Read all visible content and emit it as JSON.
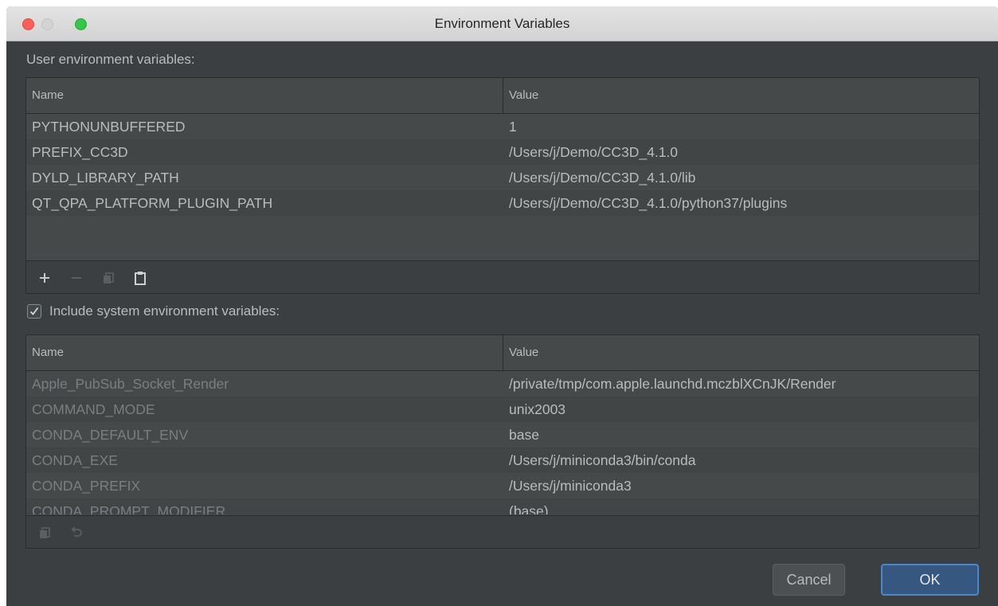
{
  "window": {
    "title": "Environment Variables"
  },
  "user_section": {
    "label": "User environment variables:",
    "columns": {
      "name": "Name",
      "value": "Value"
    },
    "rows": [
      {
        "name": "PYTHONUNBUFFERED",
        "value": "1"
      },
      {
        "name": "PREFIX_CC3D",
        "value": "/Users/j/Demo/CC3D_4.1.0"
      },
      {
        "name": "DYLD_LIBRARY_PATH",
        "value": "/Users/j/Demo/CC3D_4.1.0/lib"
      },
      {
        "name": "QT_QPA_PLATFORM_PLUGIN_PATH",
        "value": "/Users/j/Demo/CC3D_4.1.0/python37/plugins"
      }
    ],
    "toolbar": [
      "add-icon",
      "remove-icon",
      "copy-icon",
      "paste-icon"
    ]
  },
  "system_section": {
    "checkbox_label": "Include system environment variables:",
    "checked": true,
    "columns": {
      "name": "Name",
      "value": "Value"
    },
    "rows": [
      {
        "name": "Apple_PubSub_Socket_Render",
        "value": "/private/tmp/com.apple.launchd.mczblXCnJK/Render"
      },
      {
        "name": "COMMAND_MODE",
        "value": "unix2003"
      },
      {
        "name": "CONDA_DEFAULT_ENV",
        "value": "base"
      },
      {
        "name": "CONDA_EXE",
        "value": "/Users/j/miniconda3/bin/conda"
      },
      {
        "name": "CONDA_PREFIX",
        "value": "/Users/j/miniconda3"
      },
      {
        "name": "CONDA_PROMPT_MODIFIER",
        "value": "(base)"
      }
    ],
    "toolbar": [
      "copy-icon",
      "undo-icon"
    ]
  },
  "buttons": {
    "cancel": "Cancel",
    "ok": "OK"
  },
  "colors": {
    "background": "#3c3f41",
    "ok_button": "#365880",
    "ok_border": "#4a88c7"
  }
}
